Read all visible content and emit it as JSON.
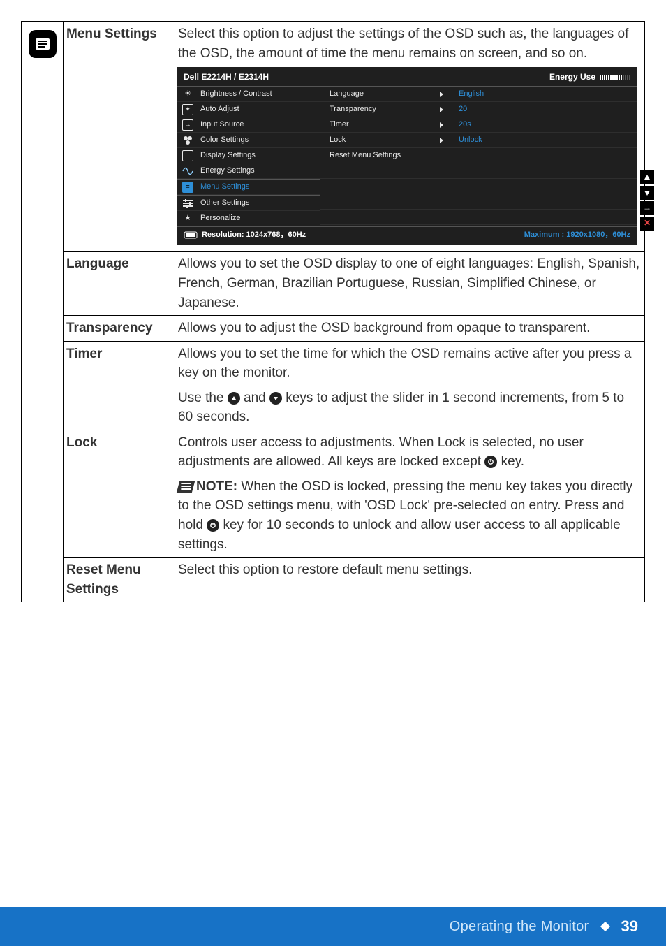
{
  "footer": {
    "title": "Operating the Monitor",
    "page": "39"
  },
  "sections": {
    "menu_settings": {
      "label": "Menu Settings",
      "body1": "Select this option to adjust the settings of the OSD such as, the languages of the OSD, the amount of time the menu remains on screen, and so on."
    },
    "language": {
      "label": "Language",
      "body": "Allows you to set the OSD display to one of eight languages: English, Spanish, French, German, Brazilian Portuguese, Russian, Simplified Chinese, or Japanese."
    },
    "transparency": {
      "label": "Transparency",
      "body": "Allows you to adjust the OSD background from opaque to transparent."
    },
    "timer": {
      "label": "Timer",
      "body1": "Allows you to set the time for which the OSD remains active after you press a key on the monitor.",
      "body2a": "Use the ",
      "body2b": " and ",
      "body2c": " keys to adjust the slider in 1 second increments, from 5 to 60 seconds."
    },
    "lock": {
      "label": "Lock",
      "body1a": "Controls user access to adjustments. When Lock is selected, no user adjustments are allowed. All keys are locked except ",
      "body1b": " key.",
      "note_label": "NOTE:",
      "note_a": " When the OSD is locked, pressing the menu key takes you directly to the OSD settings menu, with 'OSD Lock' pre-selected on entry. Press and hold ",
      "note_b": " key for 10 seconds to unlock and allow user access to all applicable settings."
    },
    "reset": {
      "label1": "Reset Menu",
      "label2": "Settings",
      "body": "Select this option to restore default menu settings."
    }
  },
  "osd": {
    "model": "Dell E2214H / E2314H",
    "energy_label": "Energy Use",
    "left_menu": [
      {
        "icon": "brightness-icon",
        "text": "Brightness / Contrast"
      },
      {
        "icon": "auto-adjust-icon",
        "text": "Auto Adjust"
      },
      {
        "icon": "input-source-icon",
        "text": "Input Source"
      },
      {
        "icon": "color-settings-icon",
        "text": "Color Settings"
      },
      {
        "icon": "display-settings-icon",
        "text": "Display Settings"
      },
      {
        "icon": "energy-settings-icon",
        "text": "Energy Settings"
      },
      {
        "icon": "menu-settings-icon",
        "text": "Menu Settings",
        "selected": true
      },
      {
        "icon": "other-settings-icon",
        "text": "Other Settings"
      },
      {
        "icon": "personalize-icon",
        "text": "Personalize"
      }
    ],
    "mid_menu": [
      {
        "text": "Language",
        "arrow": true
      },
      {
        "text": "Transparency",
        "arrow": true
      },
      {
        "text": "Timer",
        "arrow": true
      },
      {
        "text": "Lock",
        "arrow": true
      },
      {
        "text": "Reset Menu Settings",
        "arrow": false
      }
    ],
    "right_menu": [
      {
        "text": "English"
      },
      {
        "text": "20"
      },
      {
        "text": "20s"
      },
      {
        "text": "Unlock"
      }
    ],
    "resolution_label": "Resolution: 1024x768，60Hz",
    "maximum_label": "Maximum : 1920x1080，60Hz"
  }
}
